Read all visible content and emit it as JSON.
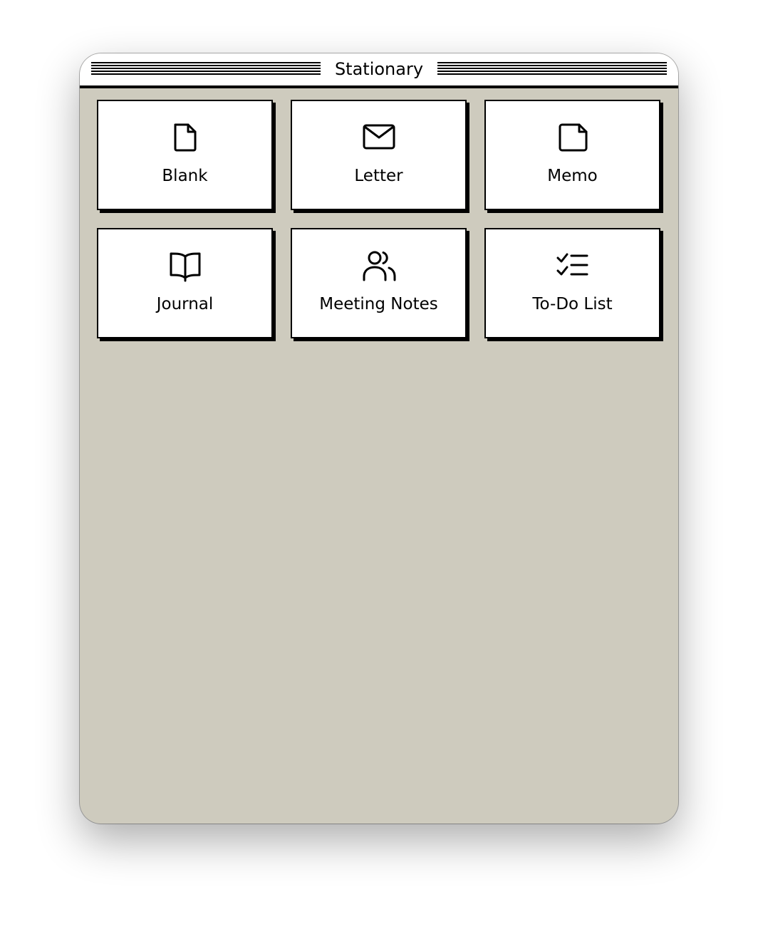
{
  "window": {
    "title": "Stationary"
  },
  "templates": [
    {
      "label": "Blank",
      "icon": "file-icon"
    },
    {
      "label": "Letter",
      "icon": "envelope-icon"
    },
    {
      "label": "Memo",
      "icon": "sticky-note-icon"
    },
    {
      "label": "Journal",
      "icon": "book-open-icon"
    },
    {
      "label": "Meeting Notes",
      "icon": "users-icon"
    },
    {
      "label": "To-Do List",
      "icon": "checklist-icon"
    }
  ],
  "colors": {
    "window_background": "#cecbbe",
    "tile_background": "#ffffff",
    "ink": "#000000"
  }
}
